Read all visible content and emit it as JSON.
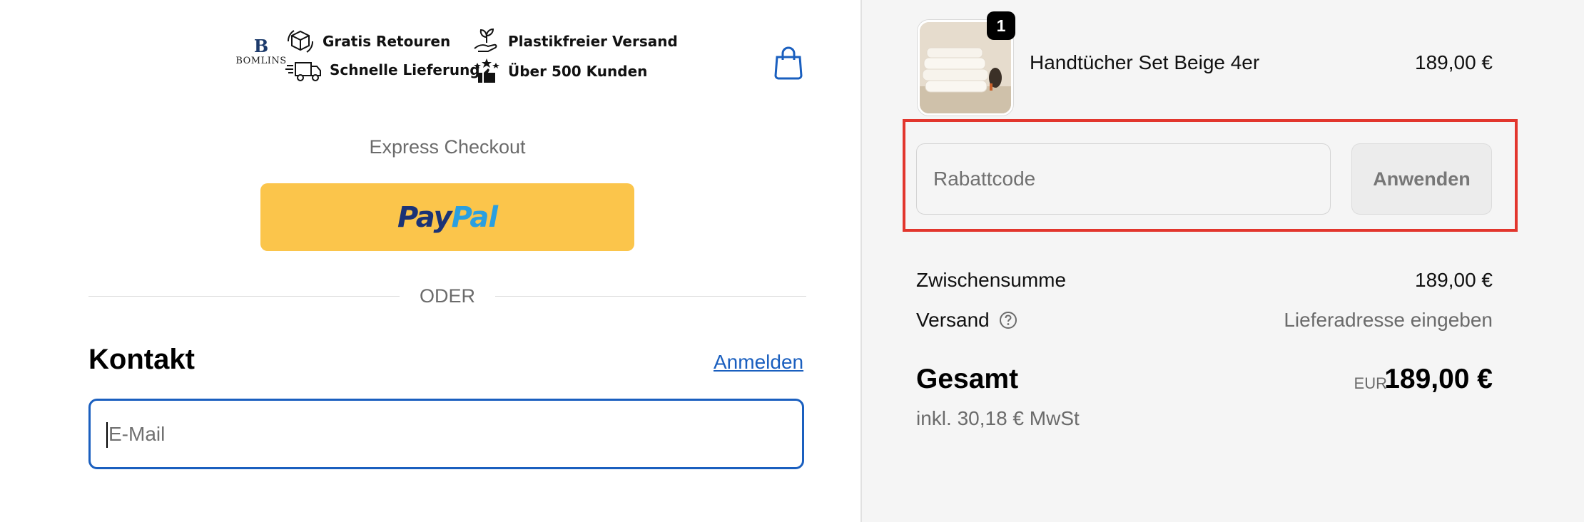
{
  "header": {
    "brand_letter": "B",
    "brand_name": "BOMLINS",
    "badges": [
      {
        "label": "Gratis Retouren",
        "icon": "box-return-icon"
      },
      {
        "label": "Schnelle Lieferung",
        "icon": "delivery-truck-icon"
      },
      {
        "label": "Plastikfreier Versand",
        "icon": "plant-hand-icon"
      },
      {
        "label": "Über 500 Kunden",
        "icon": "stars-thumbs-up-icon"
      }
    ],
    "cart_icon": "shopping-bag-icon"
  },
  "express": {
    "title": "Express Checkout",
    "paypal_pay": "Pay",
    "paypal_pal": "Pal"
  },
  "divider_text": "ODER",
  "contact": {
    "title": "Kontakt",
    "login_link": "Anmelden",
    "email_placeholder": "E-Mail"
  },
  "order": {
    "item": {
      "name": "Handtücher Set Beige 4er",
      "price": "189,00 €",
      "quantity": "1"
    },
    "discount": {
      "placeholder": "Rabattcode",
      "apply_label": "Anwenden"
    },
    "subtotal_label": "Zwischensumme",
    "subtotal_value": "189,00 €",
    "shipping_label": "Versand",
    "shipping_value": "Lieferadresse eingeben",
    "total_label": "Gesamt",
    "total_currency": "EUR",
    "total_value": "189,00 €",
    "tax_note": "inkl. 30,18 € MwSt"
  },
  "colors": {
    "accent_blue": "#1a5fbf",
    "paypal_yellow": "#fbc54b",
    "highlight_red": "#e2362d",
    "sidebar_bg": "#f5f5f5"
  }
}
